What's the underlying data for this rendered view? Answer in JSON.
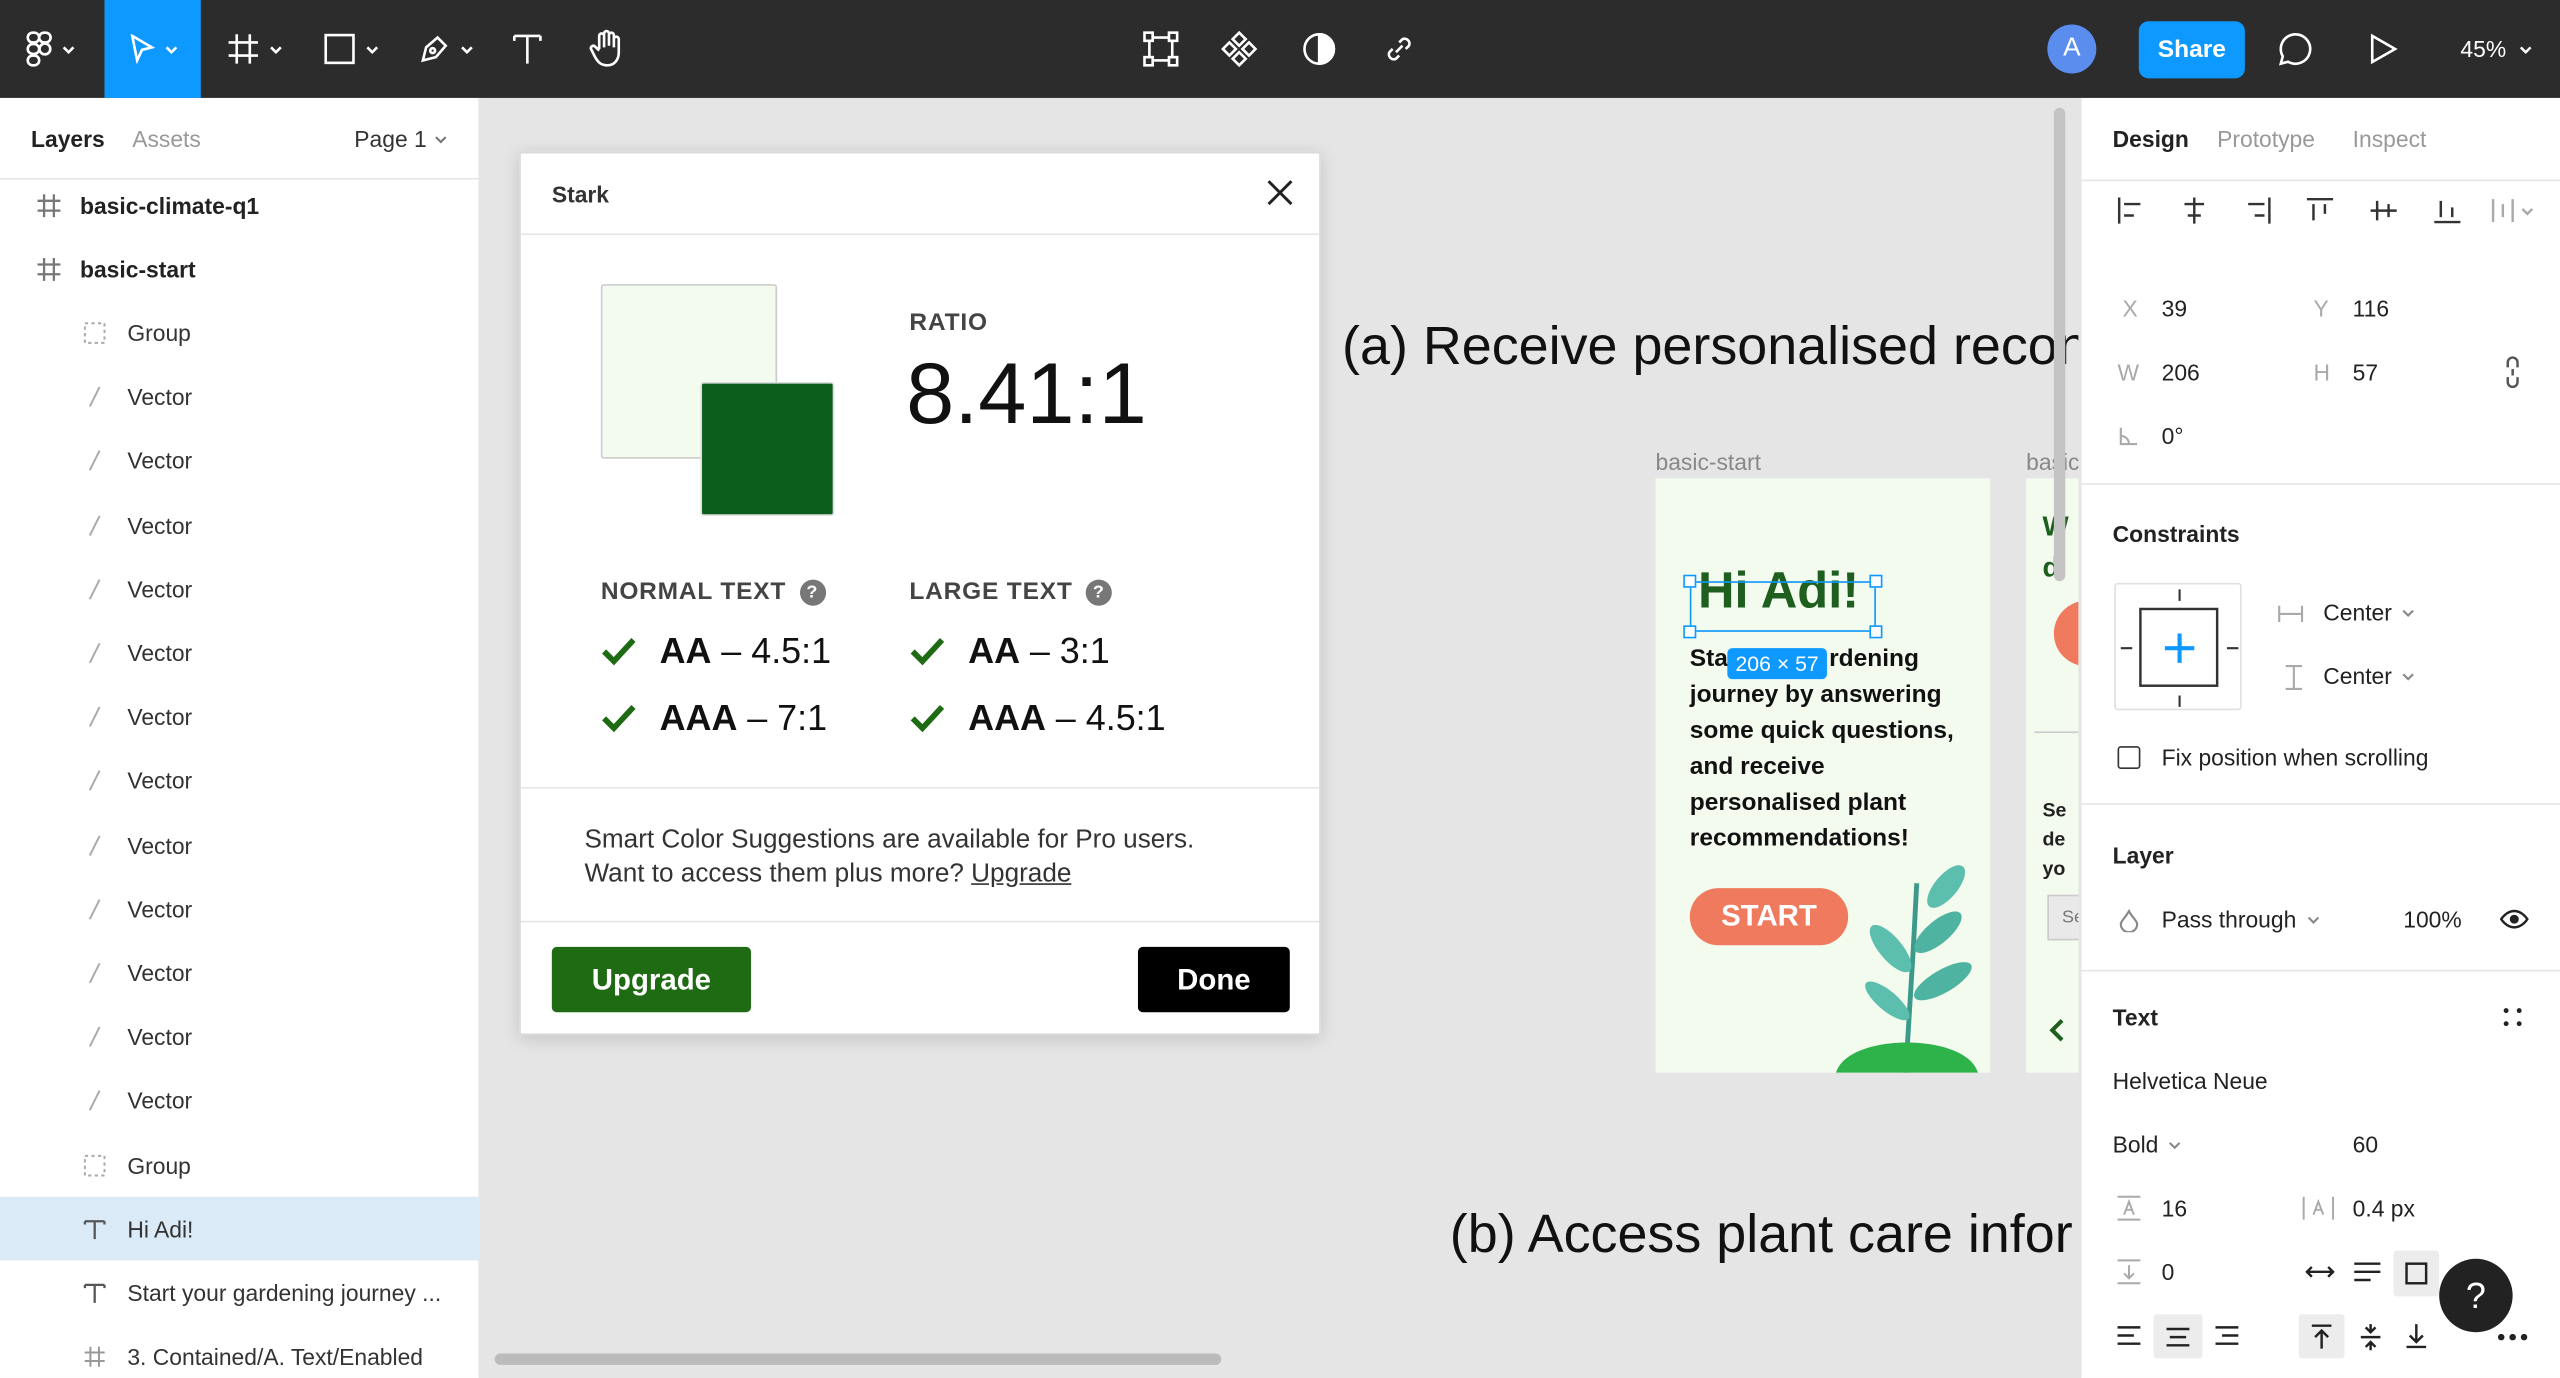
{
  "toolbar": {
    "tools": [
      "main-menu",
      "move",
      "frame",
      "shape",
      "pen",
      "text",
      "hand"
    ],
    "center_tools": [
      "edit-object",
      "component",
      "mask",
      "link"
    ],
    "avatar_initial": "A",
    "share_label": "Share",
    "zoom_label": "45%"
  },
  "left_panel": {
    "tabs": {
      "layers": "Layers",
      "assets": "Assets"
    },
    "page_selector": "Page 1",
    "layers": [
      {
        "name": "basic-climate-q1",
        "kind": "frame"
      },
      {
        "name": "basic-start",
        "kind": "frame"
      },
      {
        "name": "Group",
        "kind": "group"
      },
      {
        "name": "Vector",
        "kind": "vector"
      },
      {
        "name": "Vector",
        "kind": "vector"
      },
      {
        "name": "Vector",
        "kind": "vector"
      },
      {
        "name": "Vector",
        "kind": "vector"
      },
      {
        "name": "Vector",
        "kind": "vector"
      },
      {
        "name": "Vector",
        "kind": "vector"
      },
      {
        "name": "Vector",
        "kind": "vector"
      },
      {
        "name": "Vector",
        "kind": "vector"
      },
      {
        "name": "Vector",
        "kind": "vector"
      },
      {
        "name": "Vector",
        "kind": "vector"
      },
      {
        "name": "Vector",
        "kind": "vector"
      },
      {
        "name": "Vector",
        "kind": "vector"
      },
      {
        "name": "Group",
        "kind": "group"
      },
      {
        "name": "Hi Adi!",
        "kind": "text",
        "selected": true
      },
      {
        "name": "Start your gardening journey ...",
        "kind": "text"
      },
      {
        "name": "3. Contained/A. Text/Enabled",
        "kind": "frame-child"
      }
    ]
  },
  "canvas": {
    "heading_a": "(a) Receive personalised recon",
    "heading_b": "(b) Access plant care infor",
    "frame_label_1": "basic-start",
    "frame_label_2": "basic",
    "phone": {
      "greeting": "Hi Adi!",
      "intro_prefix": "Sta",
      "intro_suffix": "rdening",
      "intro_rest": "journey by answering some quick questions, and receive personalised plant recommendations!",
      "start_label": "START"
    },
    "selection_size": "206 × 57",
    "partial_frame_text": {
      "line1": "W",
      "line2": "d",
      "line3": "Se",
      "line4": "de",
      "line5": "yo",
      "input": "Se"
    }
  },
  "stark": {
    "title": "Stark",
    "ratio_label": "RATIO",
    "ratio_value": "8.41:1",
    "foreground_color": "#f3fbef",
    "background_color": "#0b5e1c",
    "normal_text_label": "NORMAL TEXT",
    "large_text_label": "LARGE TEXT",
    "normal_aa_level": "AA",
    "normal_aa_req": "– 4.5:1",
    "normal_aaa_level": "AAA",
    "normal_aaa_req": "– 7:1",
    "large_aa_level": "AA",
    "large_aa_req": "– 3:1",
    "large_aaa_level": "AAA",
    "large_aaa_req": "– 4.5:1",
    "promo_line1": "Smart Color Suggestions are available for Pro users.",
    "promo_line2": "Want to access them plus more?",
    "promo_link": "Upgrade",
    "upgrade_button": "Upgrade",
    "done_button": "Done",
    "pass_color": "#1e6b14"
  },
  "right_panel": {
    "tabs": {
      "design": "Design",
      "prototype": "Prototype",
      "inspect": "Inspect"
    },
    "x_label": "X",
    "x_value": "39",
    "y_label": "Y",
    "y_value": "116",
    "w_label": "W",
    "w_value": "206",
    "h_label": "H",
    "h_value": "57",
    "rotation_value": "0°",
    "constraints_title": "Constraints",
    "constraint_h": "Center",
    "constraint_v": "Center",
    "fix_position_label": "Fix position when scrolling",
    "layer_title": "Layer",
    "blend_mode": "Pass through",
    "opacity": "100%",
    "text_title": "Text",
    "font_family": "Helvetica Neue",
    "font_weight": "Bold",
    "font_size": "60",
    "line_height": "16",
    "letter_spacing": "0.4 px",
    "paragraph_spacing": "0",
    "accent_color": "#0d99ff"
  },
  "help_label": "?"
}
